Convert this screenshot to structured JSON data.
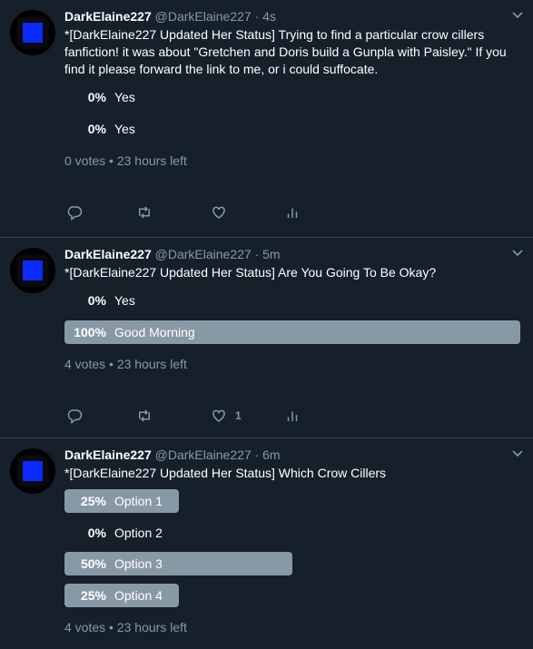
{
  "tweets": [
    {
      "name": "DarkElaine227",
      "handle": "@DarkElaine227",
      "time": "4s",
      "dot": "·",
      "text": "*[DarkElaine227 Updated Her Status] Trying to find a particular crow cillers fanfiction! it was about \"Gretchen and Doris build a Gunpla with Paisley.\"  If you find it please forward the link to me, or i could suffocate.",
      "options": [
        {
          "percent": "0%",
          "label": "Yes",
          "value": 0
        },
        {
          "percent": "0%",
          "label": "Yes",
          "value": 0
        }
      ],
      "meta": "0 votes • 23 hours left",
      "like_count": ""
    },
    {
      "name": "DarkElaine227",
      "handle": "@DarkElaine227",
      "time": "5m",
      "dot": "·",
      "text": "*[DarkElaine227 Updated Her Status] Are You Going To Be Okay?",
      "options": [
        {
          "percent": "0%",
          "label": "Yes",
          "value": 0
        },
        {
          "percent": "100%",
          "label": "Good Morning",
          "value": 100
        }
      ],
      "meta": "4 votes • 23 hours left",
      "like_count": "1"
    },
    {
      "name": "DarkElaine227",
      "handle": "@DarkElaine227",
      "time": "6m",
      "dot": "·",
      "text": "*[DarkElaine227 Updated Her Status] Which Crow Cillers",
      "options": [
        {
          "percent": "25%",
          "label": "Option 1",
          "value": 25
        },
        {
          "percent": "0%",
          "label": "Option 2",
          "value": 0
        },
        {
          "percent": "50%",
          "label": "Option 3",
          "value": 50
        },
        {
          "percent": "25%",
          "label": "Option 4",
          "value": 25
        }
      ],
      "meta": "4 votes • 23 hours left",
      "like_count": ""
    }
  ],
  "colors": {
    "background": "#15202b",
    "border": "#38444d",
    "muted": "#8899a6",
    "poll_bar": "#8899a6",
    "avatar_screen": "#0b2bff"
  },
  "icons": [
    "reply-icon",
    "retweet-icon",
    "like-icon",
    "analytics-icon",
    "chevron-down-icon"
  ]
}
